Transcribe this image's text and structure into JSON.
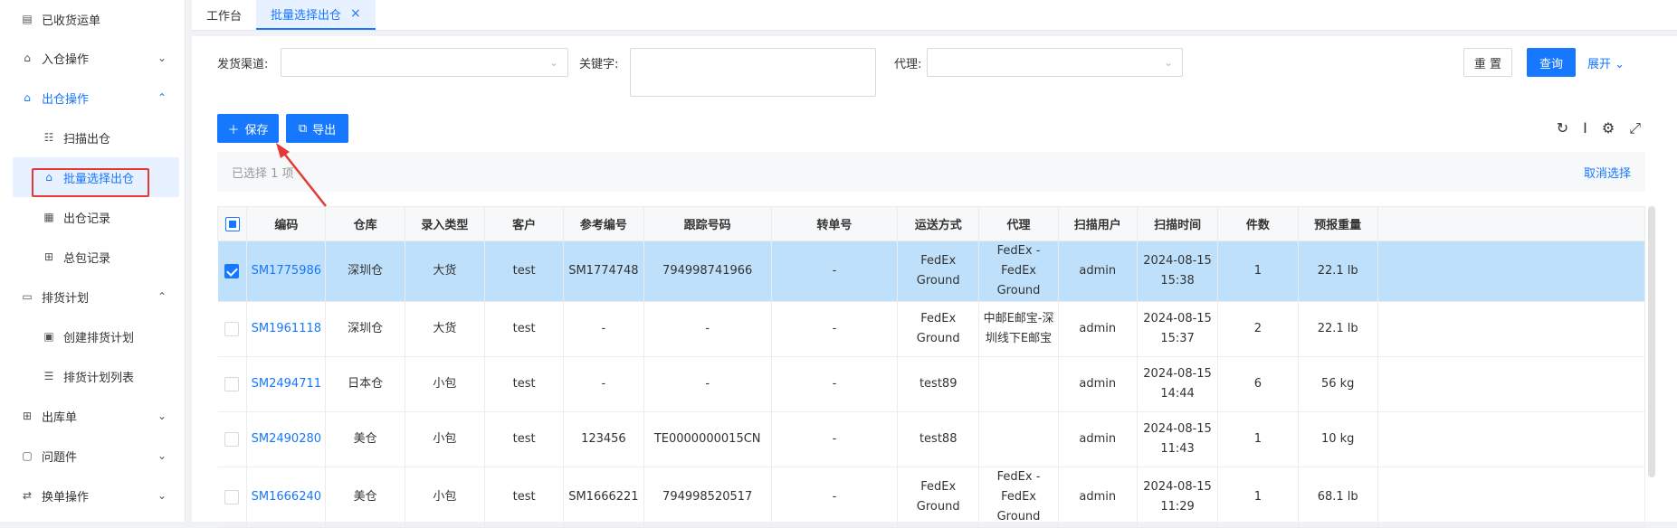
{
  "sidebar": {
    "items": [
      {
        "label": "已收货运单",
        "icon": "list-icon"
      },
      {
        "label": "入仓操作",
        "icon": "warehouse-icon",
        "chevron": "⌄"
      },
      {
        "label": "出仓操作",
        "icon": "warehouse-icon",
        "chevron": "⌃"
      },
      {
        "label": "扫描出仓",
        "icon": "scan-icon"
      },
      {
        "label": "批量选择出仓",
        "icon": "home-icon"
      },
      {
        "label": "出仓记录",
        "icon": "record-icon"
      },
      {
        "label": "总包记录",
        "icon": "grid-icon"
      },
      {
        "label": "排货计划",
        "icon": "plan-icon",
        "chevron": "⌃"
      },
      {
        "label": "创建排货计划",
        "icon": "clipboard-icon"
      },
      {
        "label": "排货计划列表",
        "icon": "menu-icon"
      },
      {
        "label": "出库单",
        "icon": "grid-icon",
        "chevron": "⌄"
      },
      {
        "label": "问题件",
        "icon": "monitor-icon",
        "chevron": "⌄"
      },
      {
        "label": "换单操作",
        "icon": "swap-icon",
        "chevron": "⌄"
      }
    ]
  },
  "tabs": [
    {
      "label": "工作台"
    },
    {
      "label": "批量选择出仓",
      "close": "×"
    }
  ],
  "filter": {
    "channel_label": "发货渠道:",
    "keyword_label": "关键字:",
    "agent_label": "代理:",
    "reset_label": "重 置",
    "query_label": "查询",
    "expand_label": "展开 ⌄"
  },
  "toolbar": {
    "save_label": "保存",
    "export_label": "导出"
  },
  "selection": {
    "text": "已选择 1 项",
    "cancel_label": "取消选择"
  },
  "table": {
    "headers": [
      "编码",
      "仓库",
      "录入类型",
      "客户",
      "参考编号",
      "跟踪号码",
      "转单号",
      "运送方式",
      "代理",
      "扫描用户",
      "扫描时间",
      "件数",
      "预报重量"
    ],
    "rows": [
      {
        "checked": true,
        "cells": [
          "SM1775986",
          "深圳仓",
          "大货",
          "test",
          "SM1774748",
          "794998741966",
          "-",
          "FedEx Ground",
          "FedEx -FedEx Ground",
          "admin",
          "2024-08-15 15:38",
          "1",
          "22.1 lb"
        ]
      },
      {
        "checked": false,
        "cells": [
          "SM1961118",
          "深圳仓",
          "大货",
          "test",
          "-",
          "-",
          "-",
          "FedEx Ground",
          "中邮E邮宝-深圳线下E邮宝",
          "admin",
          "2024-08-15 15:37",
          "2",
          "22.1 lb"
        ]
      },
      {
        "checked": false,
        "cells": [
          "SM2494711",
          "日本仓",
          "小包",
          "test",
          "-",
          "-",
          "-",
          "test89",
          "",
          "admin",
          "2024-08-15 14:44",
          "6",
          "56 kg"
        ]
      },
      {
        "checked": false,
        "cells": [
          "SM2490280",
          "美仓",
          "小包",
          "test",
          "123456",
          "TE0000000015CN",
          "-",
          "test88",
          "",
          "admin",
          "2024-08-15 11:43",
          "1",
          "10 kg"
        ]
      },
      {
        "checked": false,
        "cells": [
          "SM1666240",
          "美仓",
          "小包",
          "test",
          "SM1666221",
          "794998520517",
          "-",
          "FedEx Ground",
          "FedEx -FedEx Ground",
          "admin",
          "2024-08-15 11:29",
          "1",
          "68.1 lb"
        ]
      }
    ]
  },
  "colors": {
    "accent": "#1677ff",
    "selected_row": "#bfe0fa",
    "annotation": "#e53935"
  }
}
